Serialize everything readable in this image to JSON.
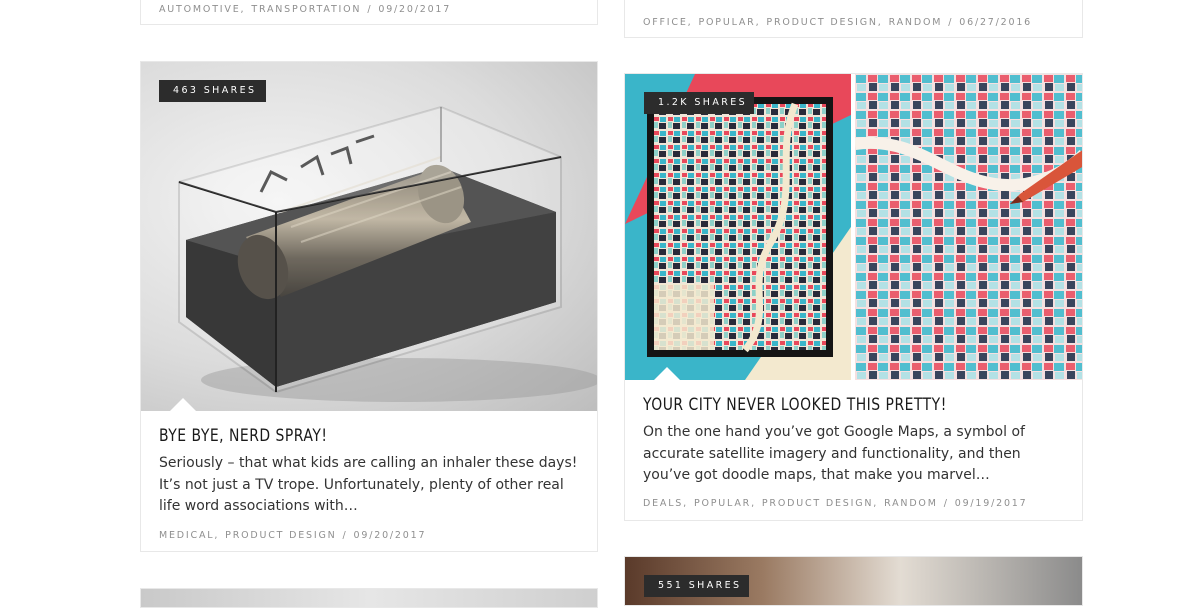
{
  "top_left_card": {
    "tags": [
      "AUTOMOTIVE",
      "TRANSPORTATION"
    ],
    "date": "09/20/2017"
  },
  "top_right_card": {
    "tags": [
      "OFFICE",
      "POPULAR",
      "PRODUCT DESIGN",
      "RANDOM"
    ],
    "date": "06/27/2016"
  },
  "card_nerd_spray": {
    "shares": "463 SHARES",
    "title": "BYE BYE, NERD SPRAY!",
    "excerpt": "Seriously – that what kids are calling an inhaler these days! It’s not just a TV trope. Unfortunately, plenty of other real life word associations with…",
    "tags": [
      "MEDICAL",
      "PRODUCT DESIGN"
    ],
    "date": "09/20/2017"
  },
  "card_city": {
    "shares": "1.2K SHARES",
    "title": "YOUR CITY NEVER LOOKED THIS PRETTY!",
    "excerpt": "On the one hand you’ve got Google Maps, a symbol of accurate satellite imagery and functionality, and then you’ve got doodle maps, that make you marvel…",
    "tags": [
      "DEALS",
      "POPULAR",
      "PRODUCT DESIGN",
      "RANDOM"
    ],
    "date": "09/19/2017"
  },
  "card_bottom_right": {
    "shares": "551 SHARES"
  },
  "colors": {
    "badge_bg": "#2c2c2c",
    "meta_text": "#8f8f8f",
    "title_text": "#1a1a1a",
    "map_red": "#e8485a",
    "map_cyan": "#3ab5c9",
    "map_cream": "#f3e9cf"
  }
}
